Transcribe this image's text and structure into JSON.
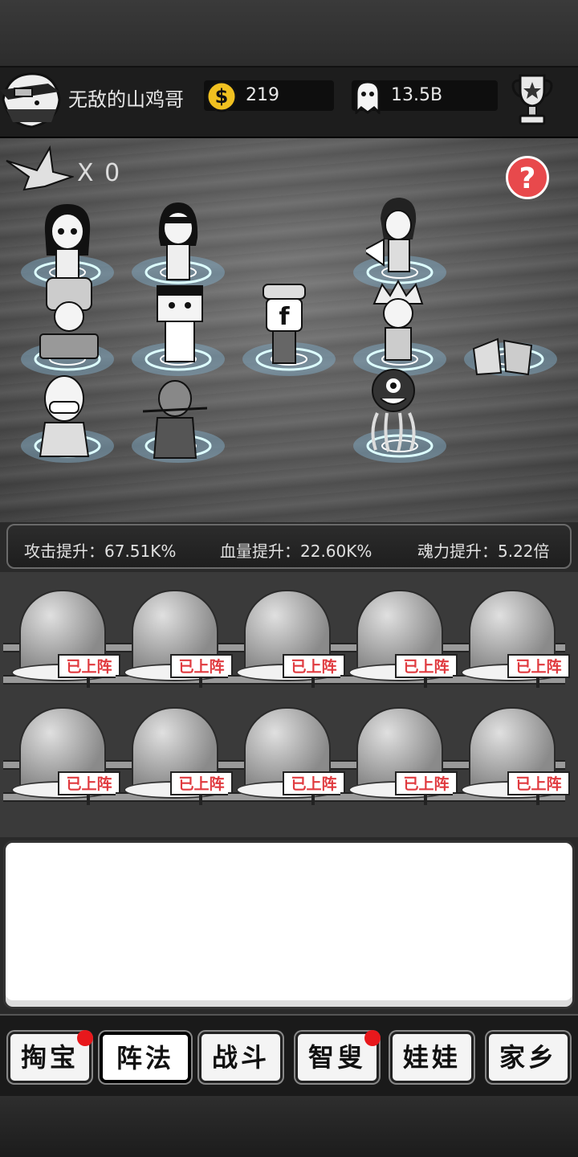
{
  "header": {
    "player_name": "无敌的山鸡哥",
    "coins": "219",
    "souls": "13.5B"
  },
  "battlefield": {
    "crane_count": "X 0",
    "help_label": "?"
  },
  "stats": {
    "attack": "攻击提升：67.51K%",
    "hp": "血量提升：22.60K%",
    "soul": "魂力提升：5.22倍"
  },
  "roster": {
    "deployed_label": "已上阵",
    "count": 10
  },
  "nav": {
    "items": [
      {
        "label": "掏宝",
        "badge": true
      },
      {
        "label": "阵法",
        "badge": false,
        "active": true
      },
      {
        "label": "战斗",
        "badge": false
      },
      {
        "label": "智叟",
        "badge": true
      },
      {
        "label": "娃娃",
        "badge": false
      },
      {
        "label": "家乡",
        "badge": false
      }
    ]
  },
  "colors": {
    "badge_red": "#e8181c",
    "help_red": "#e8494c",
    "coin_gold": "#f0c020",
    "sign_red": "#e03a3f"
  }
}
